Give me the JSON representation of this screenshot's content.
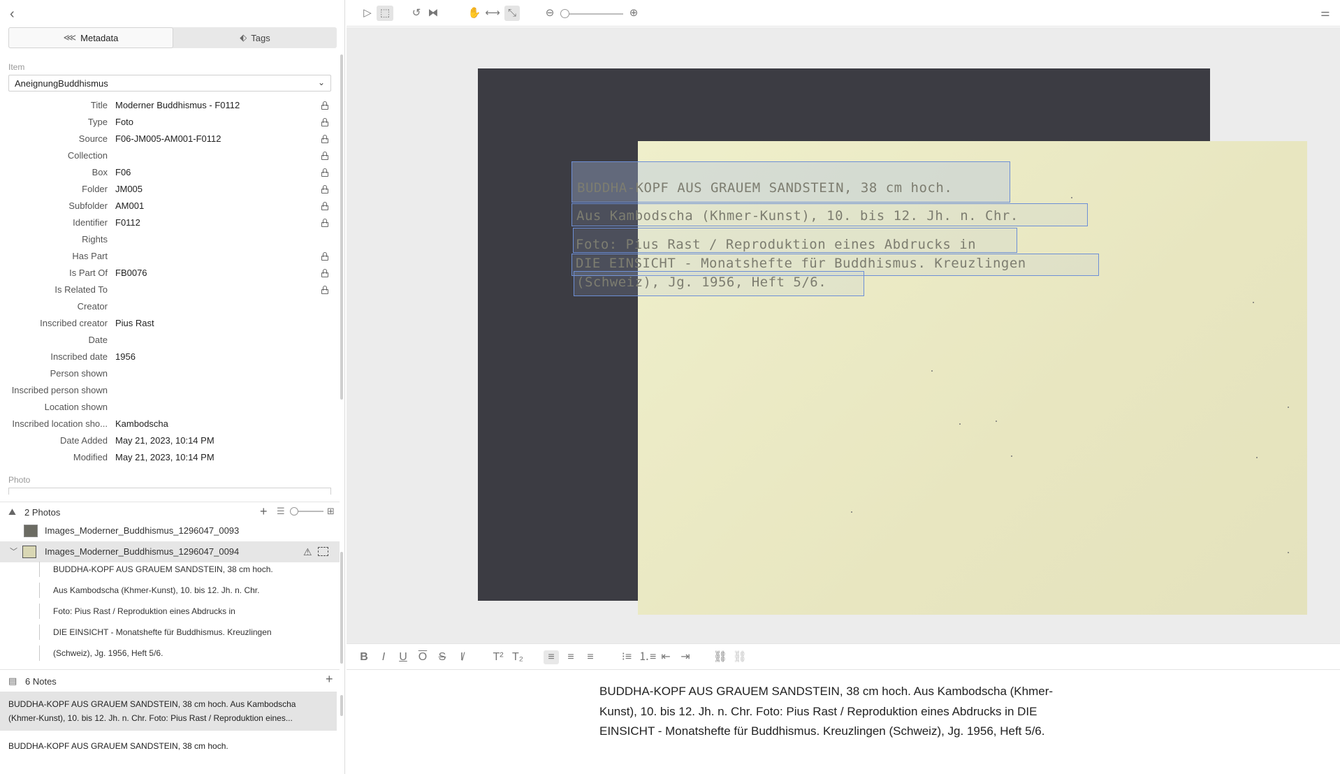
{
  "left": {
    "tabs": {
      "metadata": "Metadata",
      "tags": "Tags"
    },
    "item_label": "Item",
    "item_select": "AneignungBuddhismus",
    "fields": [
      {
        "key": "Title",
        "value": "Moderner Buddhismus - F0112",
        "locked": true
      },
      {
        "key": "Type",
        "value": "Foto",
        "locked": true
      },
      {
        "key": "Source",
        "value": "F06-JM005-AM001-F0112",
        "locked": true
      },
      {
        "key": "Collection",
        "value": "",
        "locked": true
      },
      {
        "key": "Box",
        "value": "F06",
        "locked": true
      },
      {
        "key": "Folder",
        "value": "JM005",
        "locked": true
      },
      {
        "key": "Subfolder",
        "value": "AM001",
        "locked": true
      },
      {
        "key": "Identifier",
        "value": "F0112",
        "locked": true
      },
      {
        "key": "Rights",
        "value": "",
        "locked": false
      },
      {
        "key": "Has Part",
        "value": "",
        "locked": true
      },
      {
        "key": "Is Part Of",
        "value": "FB0076",
        "locked": true
      },
      {
        "key": "Is Related To",
        "value": "",
        "locked": true
      },
      {
        "key": "Creator",
        "value": "",
        "locked": false
      },
      {
        "key": "Inscribed creator",
        "value": "Pius Rast",
        "locked": false
      },
      {
        "key": "Date",
        "value": "",
        "locked": false
      },
      {
        "key": "Inscribed date",
        "value": "1956",
        "locked": false
      },
      {
        "key": "Person shown",
        "value": "",
        "locked": false
      },
      {
        "key": "Inscribed person shown",
        "value": "",
        "locked": false
      },
      {
        "key": "Location shown",
        "value": "",
        "locked": false
      },
      {
        "key": "Inscribed location sho...",
        "value": "Kambodscha",
        "locked": false
      },
      {
        "key": "Date Added",
        "value": "May 21, 2023, 10:14 PM",
        "locked": false
      },
      {
        "key": "Modified",
        "value": "May 21, 2023, 10:14 PM",
        "locked": false
      }
    ],
    "photo_label": "Photo",
    "photos": {
      "title": "2 Photos",
      "items": [
        {
          "label": "Images_Moderner_Buddhismus_1296047_0093"
        },
        {
          "label": "Images_Moderner_Buddhismus_1296047_0094"
        }
      ],
      "selections": [
        "BUDDHA-KOPF AUS GRAUEM SANDSTEIN, 38 cm hoch.",
        "Aus Kambodscha (Khmer-Kunst), 10. bis 12. Jh. n. Chr.",
        "Foto: Pius Rast / Reproduktion eines Abdrucks in",
        "DIE EINSICHT - Monatshefte für Buddhismus. Kreuzlingen",
        "(Schweiz), Jg. 1956, Heft 5/6."
      ]
    },
    "notes": {
      "title": "6 Notes",
      "items": [
        "BUDDHA-KOPF AUS GRAUEM SANDSTEIN, 38 cm hoch. Aus Kambodscha (Khmer-Kunst), 10. bis 12. Jh. n. Chr. Foto: Pius Rast / Reproduktion eines...",
        "BUDDHA-KOPF AUS GRAUEM SANDSTEIN, 38 cm hoch."
      ]
    }
  },
  "viewer": {
    "zoom_fraction": 0.0,
    "ocr_lines": [
      "BUDDHA-KOPF AUS GRAUEM SANDSTEIN, 38 cm hoch.",
      "Aus Kambodscha (Khmer-Kunst), 10. bis 12. Jh. n. Chr.",
      "Foto: Pius Rast / Reproduktion eines Abdrucks in",
      "DIE EINSICHT - Monatshefte für Buddhismus. Kreuzlingen",
      "(Schweiz), Jg. 1956, Heft 5/6."
    ]
  },
  "editor": {
    "text": "BUDDHA-KOPF AUS GRAUEM SANDSTEIN, 38 cm hoch. Aus Kambodscha (Khmer-Kunst), 10. bis 12. Jh. n. Chr. Foto: Pius Rast / Reproduktion eines Abdrucks in DIE EINSICHT - Monatshefte für Buddhismus. Kreuzlingen (Schweiz), Jg. 1956, Heft 5/6."
  }
}
